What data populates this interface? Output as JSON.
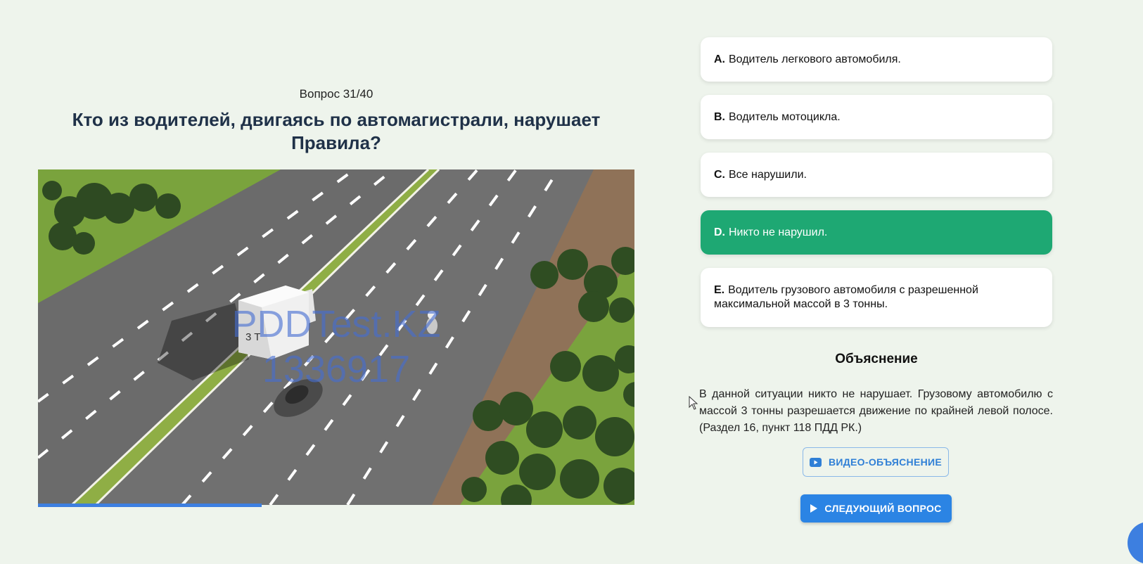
{
  "question": {
    "counter": "Вопрос 31/40",
    "text": "Кто из водителей, двигаясь по автомагистрали, нарушает Правила?",
    "progress_fraction": 0.375,
    "watermark": {
      "brand": "PDDTest.KZ",
      "id": "1336917"
    },
    "scene_labels": {
      "truck_plate": "3 T"
    }
  },
  "answers": [
    {
      "letter": "A.",
      "text": "Водитель легкового автомобиля.",
      "selected": false
    },
    {
      "letter": "B.",
      "text": "Водитель мотоцикла.",
      "selected": false
    },
    {
      "letter": "C.",
      "text": "Все нарушили.",
      "selected": false
    },
    {
      "letter": "D.",
      "text": "Никто не нарушил.",
      "selected": true
    },
    {
      "letter": "E.",
      "text": "Водитель грузового автомобиля с разрешенной максимальной массой в 3 тонны.",
      "selected": false
    }
  ],
  "explanation": {
    "title": "Объяснение",
    "text": "В данной ситуации никто не нарушает. Грузовому автомобилю с массой 3 тонны разрешается движение по крайней левой полосе. (Раздел 16, пункт 118 ПДД РК.)"
  },
  "buttons": {
    "video_label": "ВИДЕО-ОБЪЯСНЕНИЕ",
    "next_label": "СЛЕДУЮЩИЙ ВОПРОС"
  },
  "colors": {
    "selected": "#1ea873",
    "accent": "#2b84e4",
    "background": "#eef4ec"
  },
  "icons": {
    "video": "youtube-icon",
    "next": "play-icon"
  }
}
